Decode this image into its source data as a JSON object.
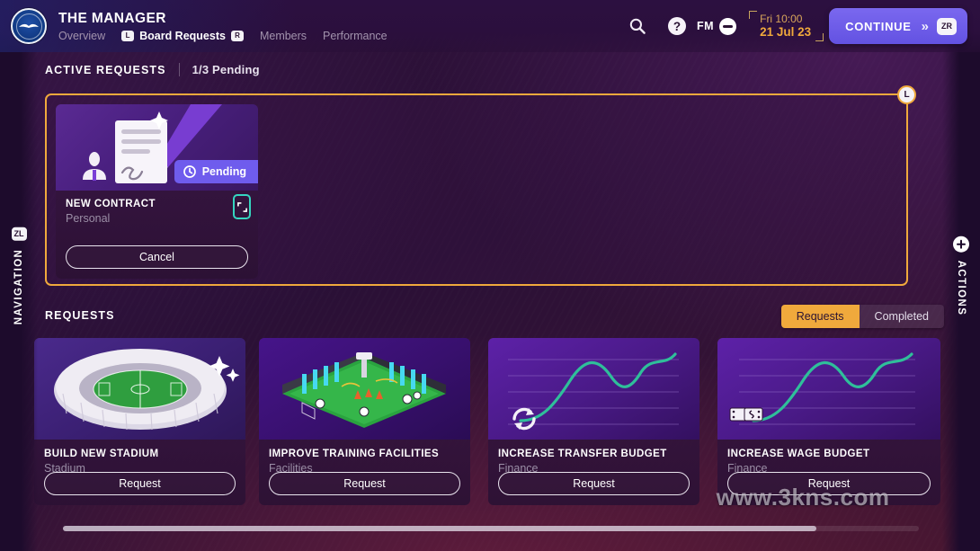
{
  "header": {
    "club_crest": "brighton-crest-icon",
    "app_title": "THE MANAGER",
    "nav_tabs": [
      {
        "label": "Overview",
        "active": false,
        "key_left": "",
        "key_right": ""
      },
      {
        "label": "Board Requests",
        "active": true,
        "key_left": "L",
        "key_right": "R"
      },
      {
        "label": "Members",
        "active": false,
        "key_left": "",
        "key_right": ""
      },
      {
        "label": "Performance",
        "active": false,
        "key_left": "",
        "key_right": ""
      }
    ],
    "search_icon": "search-icon",
    "help_icon": "question-mark-icon",
    "fm_label": "FM",
    "fm_icon": "minus-circle-icon",
    "date": {
      "time": "Fri 10:00",
      "day": "21 Jul 23"
    },
    "continue": {
      "label": "CONTINUE",
      "chevron": "»",
      "key": "ZR"
    }
  },
  "active_section": {
    "title": "ACTIVE REQUESTS",
    "status": "1/3 Pending",
    "panel_key": "L",
    "card": {
      "art": "contract-signing-icon",
      "badge": {
        "icon": "clock-icon",
        "label": "Pending"
      },
      "title": "NEW CONTRACT",
      "subtitle": "Personal",
      "expand_icon": "expand-icon",
      "button": "Cancel"
    }
  },
  "requests_section": {
    "title": "REQUESTS",
    "tabs": [
      {
        "label": "Requests",
        "selected": true
      },
      {
        "label": "Completed",
        "selected": false
      }
    ],
    "cards": [
      {
        "art": "stadium-icon",
        "title": "BUILD NEW STADIUM",
        "subtitle": "Stadium",
        "button": "Request"
      },
      {
        "art": "training-pitch-icon",
        "title": "IMPROVE TRAINING FACILITIES",
        "subtitle": "Facilities",
        "button": "Request"
      },
      {
        "art": "transfer-chart-icon",
        "title": "INCREASE TRANSFER BUDGET",
        "subtitle": "Finance",
        "button": "Request"
      },
      {
        "art": "wage-chart-icon",
        "title": "INCREASE WAGE BUDGET",
        "subtitle": "Finance",
        "button": "Request"
      }
    ]
  },
  "rails": {
    "left": {
      "label": "NAVIGATION",
      "key": "ZL"
    },
    "right": {
      "label": "ACTIONS",
      "icon": "plus-circle-icon"
    }
  },
  "watermark": "www.3kns.com",
  "colors": {
    "background": "#2a1233",
    "accent_orange": "#f0a93c",
    "accent_purple": "#6f5ced",
    "accent_teal": "#35d6c0",
    "chart_line": "#2fbf9a",
    "text_muted": "#9b8ea6"
  }
}
